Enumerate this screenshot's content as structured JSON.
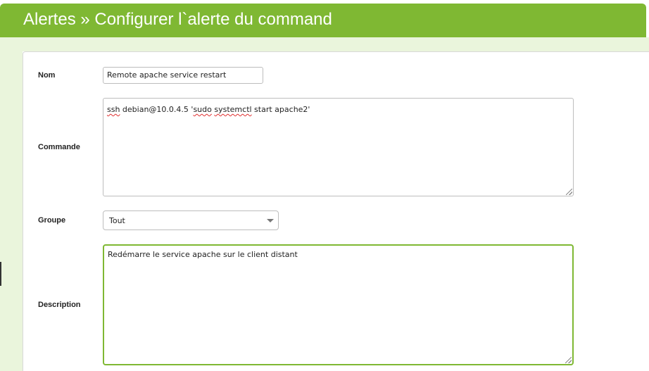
{
  "header": {
    "title": "Alertes » Configurer l`alerte du command"
  },
  "form": {
    "nom": {
      "label": "Nom",
      "value": "Remote apache service  restart"
    },
    "commande": {
      "label": "Commande",
      "value_parts": [
        "ssh",
        " debian@10.0.4.5 '",
        "sudo",
        " ",
        "systemctl",
        " start apache2'"
      ]
    },
    "groupe": {
      "label": "Groupe",
      "selected": "Tout"
    },
    "description": {
      "label": "Description",
      "value": "Redémarre le service apache sur le client distant"
    }
  },
  "colors": {
    "accent": "#7fb833",
    "header_text": "#ffffff",
    "tint": "#eaf5dc"
  },
  "icons": {
    "select_caret": "caret-down-icon",
    "resize": "resize-grip-icon"
  }
}
